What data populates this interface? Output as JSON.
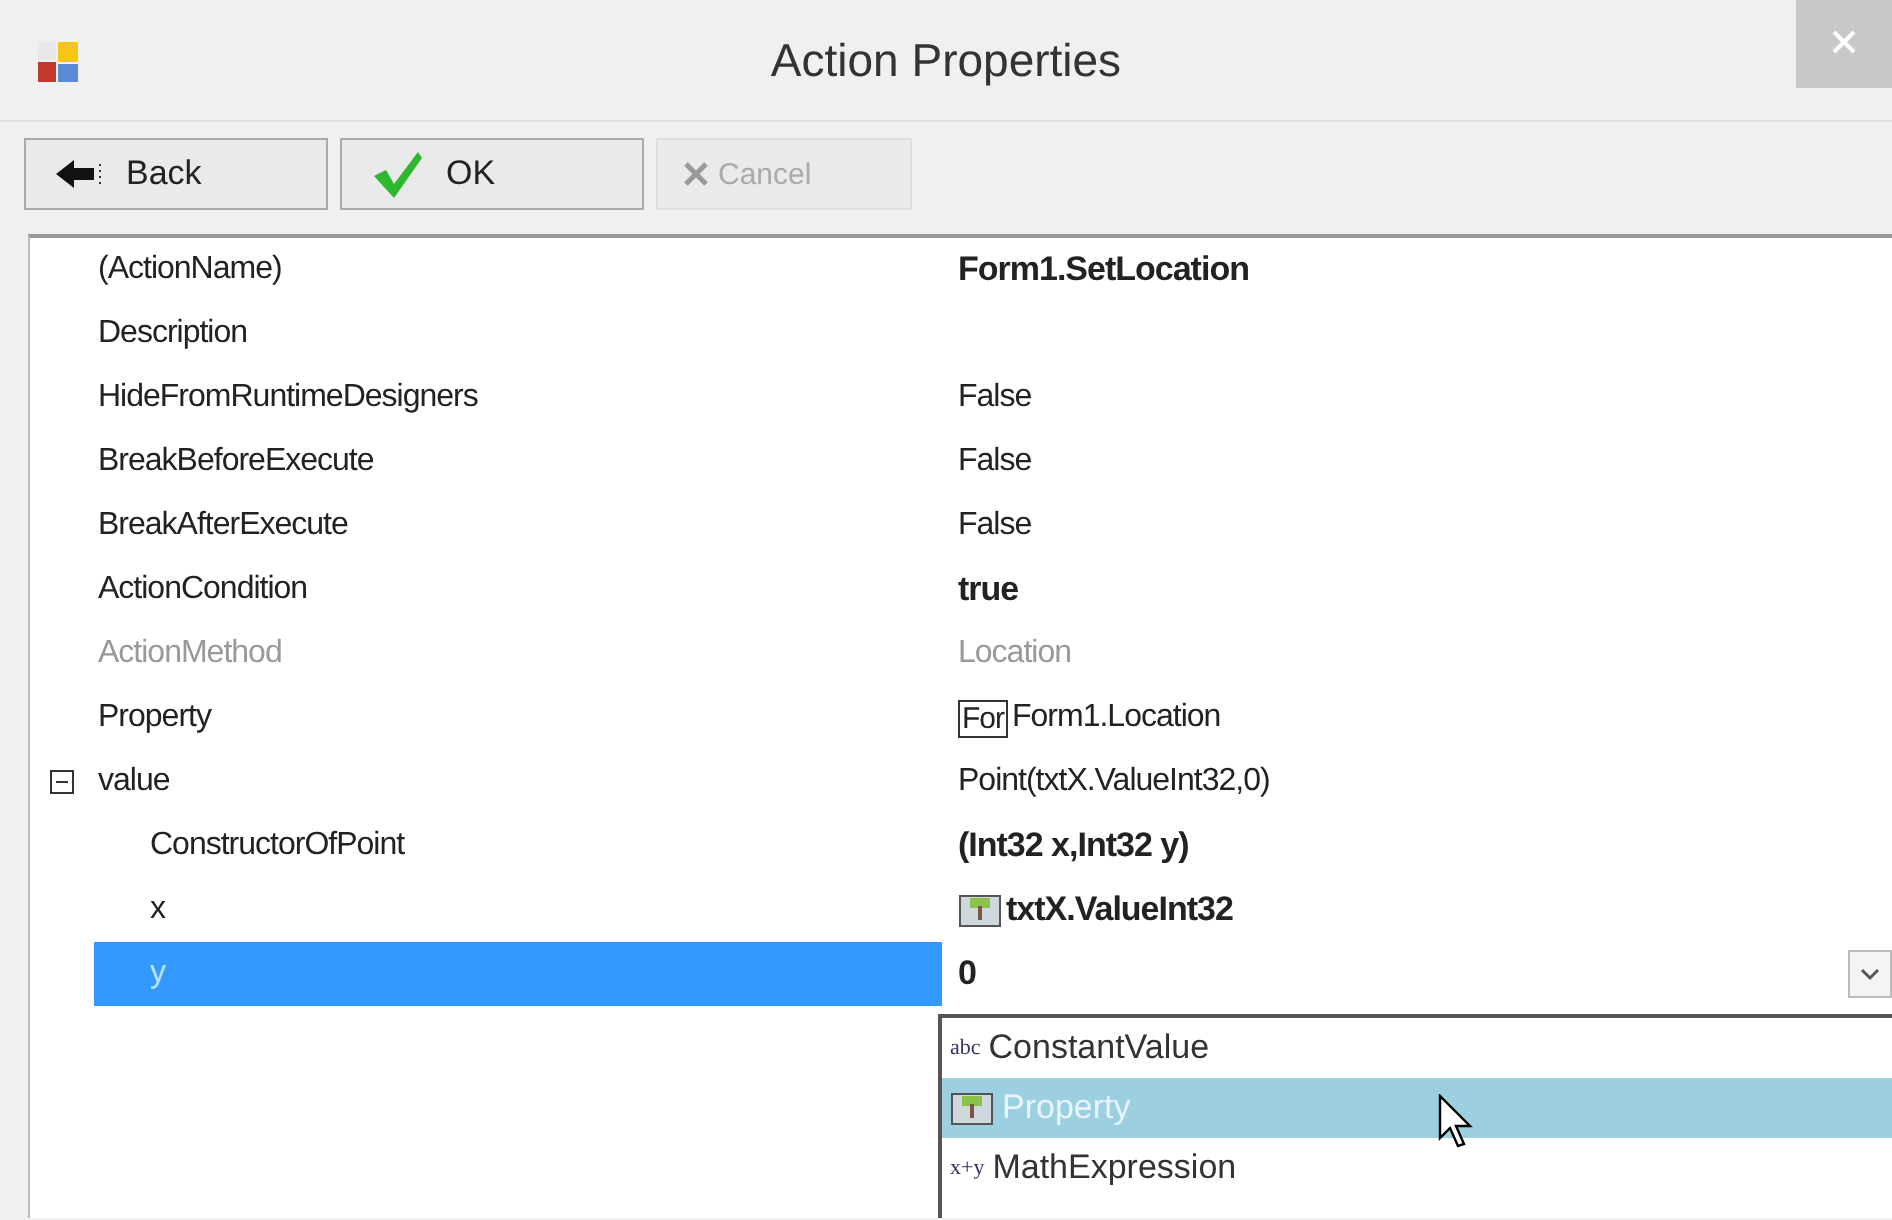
{
  "window": {
    "title": "Action Properties"
  },
  "toolbar": [
    {
      "label": "Back",
      "kind": "back",
      "disabled": false
    },
    {
      "label": "OK",
      "kind": "ok",
      "disabled": false
    },
    {
      "label": "Cancel",
      "kind": "cancel",
      "disabled": true
    }
  ],
  "properties": [
    {
      "name": "(ActionName)",
      "value": "Form1.SetLocation",
      "bold": true,
      "disabled": false,
      "selected": false
    },
    {
      "name": "Description",
      "disabled": false,
      "selected": false
    },
    {
      "name": "HideFromRuntimeDesigners",
      "value": "False",
      "bold": false,
      "disabled": false,
      "selected": false
    },
    {
      "name": "BreakBeforeExecute",
      "value": "False",
      "bold": false,
      "disabled": false,
      "selected": false
    },
    {
      "name": "BreakAfterExecute",
      "value": "False",
      "bold": false,
      "disabled": false,
      "selected": false
    },
    {
      "name": "ActionCondition",
      "value": "true",
      "bold": true,
      "disabled": false,
      "selected": false
    },
    {
      "name": "ActionMethod",
      "value": "Location",
      "bold": false,
      "disabled": true,
      "selected": false
    },
    {
      "name": "Property",
      "value": "Form1.Location",
      "badge": "For",
      "bold": false,
      "disabled": false,
      "selected": false
    },
    {
      "name": "value",
      "value": "Point(txtX.ValueInt32,0)",
      "bold": false,
      "disabled": false,
      "selected": false,
      "expanded": true,
      "children": [
        {
          "name": "ConstructorOfPoint",
          "value": "(Int32 x,Int32 y)",
          "bold": true,
          "disabled": false,
          "selected": false
        },
        {
          "name": "x",
          "value": "txtX.ValueInt32",
          "kind": "property",
          "bold": true,
          "disabled": false,
          "selected": false
        },
        {
          "name": "y",
          "value": "0",
          "bold": true,
          "disabled": false,
          "selected": true,
          "editing": true
        }
      ]
    }
  ],
  "dropdown": [
    {
      "label": "ConstantValue",
      "icon_label": "abc",
      "kind": "text",
      "selected": false
    },
    {
      "label": "Property",
      "kind": "property",
      "selected": true
    },
    {
      "label": "MathExpression",
      "icon_label": "x+y",
      "kind": "text",
      "selected": false
    }
  ]
}
